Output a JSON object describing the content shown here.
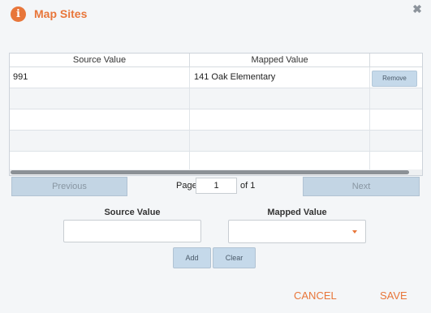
{
  "dialog": {
    "title": "Map Sites",
    "icon": "info-icon",
    "close_icon": "close-icon",
    "accent": "#e8763a"
  },
  "grid": {
    "columns": [
      "Source Value",
      "Mapped Value",
      ""
    ],
    "rows": [
      {
        "source": "991",
        "mapped": "141 Oak Elementary",
        "action": "Remove"
      },
      {
        "source": "",
        "mapped": "",
        "action": ""
      },
      {
        "source": "",
        "mapped": "",
        "action": ""
      },
      {
        "source": "",
        "mapped": "",
        "action": ""
      },
      {
        "source": "",
        "mapped": "",
        "action": ""
      }
    ]
  },
  "pager": {
    "previous": "Previous",
    "next": "Next",
    "page_label": "Page",
    "page_value": "1",
    "of_label": "of 1"
  },
  "form": {
    "source_label": "Source Value",
    "mapped_label": "Mapped Value",
    "source_value": "",
    "mapped_value": "",
    "add_label": "Add",
    "clear_label": "Clear"
  },
  "footer": {
    "cancel_label": "CANCEL",
    "save_label": "SAVE"
  }
}
